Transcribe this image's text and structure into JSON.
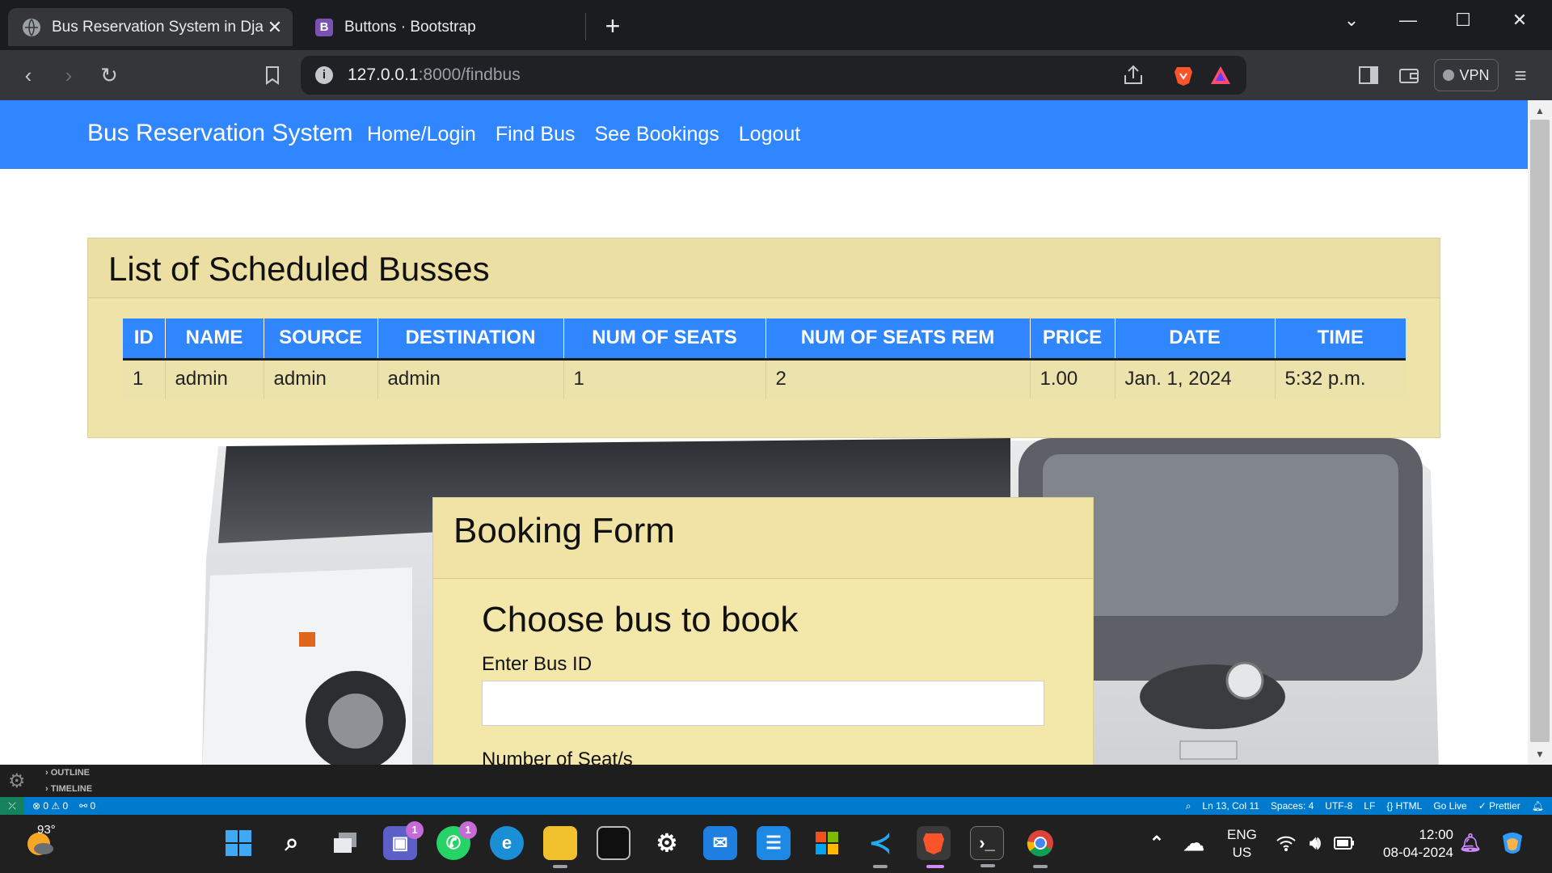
{
  "browser": {
    "tabs": [
      {
        "title": "Bus Reservation System in Djang",
        "active": true
      },
      {
        "title": "Buttons · Bootstrap",
        "active": false
      }
    ],
    "url_host": "127.0.0.1",
    "url_path": ":8000/findbus",
    "vpn_label": "VPN"
  },
  "site": {
    "brand": "Bus Reservation System",
    "nav": [
      "Home/Login",
      "Find Bus",
      "See Bookings",
      "Logout"
    ],
    "nav_color": "#2f86ff",
    "card_color": "#eee3a8"
  },
  "schedule": {
    "title": "List of Scheduled Busses",
    "columns": [
      "ID",
      "NAME",
      "SOURCE",
      "DESTINATION",
      "NUM OF SEATS",
      "NUM OF SEATS REM",
      "PRICE",
      "DATE",
      "TIME"
    ],
    "rows": [
      [
        "1",
        "admin",
        "admin",
        "admin",
        "1",
        "2",
        "1.00",
        "Jan. 1, 2024",
        "5:32 p.m."
      ]
    ]
  },
  "booking": {
    "title": "Booking Form",
    "subtitle": "Choose bus to book",
    "bus_id_label": "Enter Bus ID",
    "bus_id_value": "",
    "seats_label": "Number of Seat/s"
  },
  "vscode": {
    "outline": "OUTLINE",
    "timeline": "TIMELINE",
    "status_left": [
      "⊗ 0 ⚠ 0",
      "⚯ 0"
    ],
    "status_right": [
      "Ln 13, Col 11",
      "Spaces: 4",
      "UTF-8",
      "LF",
      "{} HTML",
      "Go Live",
      "✓ Prettier"
    ]
  },
  "taskbar": {
    "weather_temp": "93°",
    "lang_top": "ENG",
    "lang_bottom": "US",
    "time": "12:00",
    "date": "08-04-2024",
    "badges": {
      "teams": "1",
      "whatsapp": "1"
    }
  }
}
